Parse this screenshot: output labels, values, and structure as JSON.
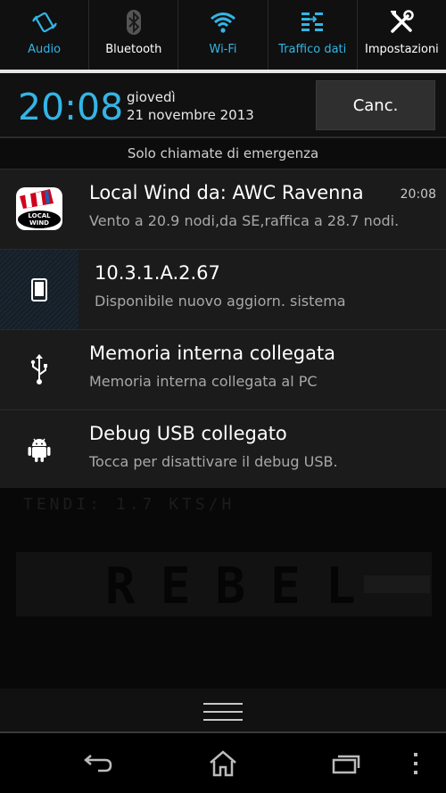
{
  "quick_settings": [
    {
      "label": "Audio",
      "icon": "vibrate-icon",
      "active": true
    },
    {
      "label": "Bluetooth",
      "icon": "bluetooth-icon",
      "active": false
    },
    {
      "label": "Wi-Fi",
      "icon": "wifi-icon",
      "active": true
    },
    {
      "label": "Traffico dati",
      "icon": "data-traffic-icon",
      "active": true
    },
    {
      "label": "Impostazioni",
      "icon": "settings-tools-icon",
      "active": false
    }
  ],
  "header": {
    "time": "20:08",
    "day": "giovedì",
    "date": "21 novembre 2013",
    "clear_label": "Canc."
  },
  "emergency_text": "Solo chiamate di emergenza",
  "notifications": [
    {
      "title": "Local Wind da: AWC Ravenna",
      "text": "Vento a 20.9 nodi,da SE,raffica a 28.7 nodi.",
      "time": "20:08",
      "icon": "local-wind-app-icon",
      "icon_label": "LOCAL WIND"
    },
    {
      "title": "10.3.1.A.2.67",
      "text": "Disponibile nuovo aggiorn. sistema",
      "time": "",
      "icon": "phone-update-icon"
    },
    {
      "title": "Memoria interna collegata",
      "text": "Memoria interna collegata al PC",
      "time": "",
      "icon": "usb-icon"
    },
    {
      "title": "Debug USB collegato",
      "text": "Tocca per disattivare il debug USB.",
      "time": "",
      "icon": "android-icon"
    }
  ],
  "background_app": {
    "line1": "TENDI: 1.7 KTS/H",
    "banner": "REBEL"
  },
  "navigation": {
    "back": "back-icon",
    "home": "home-icon",
    "recents": "recent-apps-icon",
    "menu": "menu-icon"
  },
  "colors": {
    "accent": "#33b5e5",
    "background": "#000000",
    "notification_bg": "#1b1b1b"
  }
}
